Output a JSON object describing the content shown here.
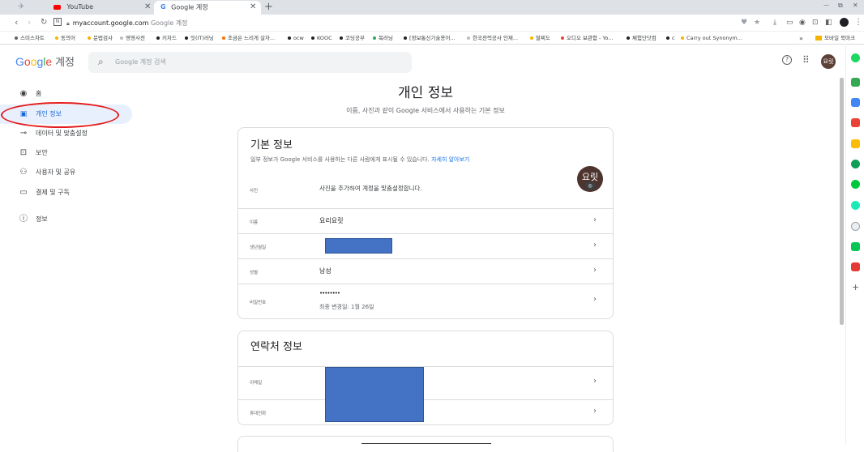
{
  "browser": {
    "tabs": [
      {
        "title": "YouTube",
        "icon": "youtube-icon"
      },
      {
        "title": "Google 계정",
        "icon": "google-g-icon"
      }
    ],
    "new_tab": "+",
    "window_controls": {
      "minimize": "—",
      "restore": "⧉",
      "close": "✕"
    },
    "address": {
      "domain": "myaccount.google.com",
      "page_title": "Google 계정"
    },
    "bookmarks": [
      {
        "label": "스미스차트",
        "color": "#5f6368"
      },
      {
        "label": "동의어",
        "color": "#f4b400"
      },
      {
        "label": "문법검사",
        "color": "#f4b400"
      },
      {
        "label": "영영사전",
        "color": "#bdbdbd"
      },
      {
        "label": "키차드",
        "color": "#202124"
      },
      {
        "label": "잇(IT)러닝",
        "color": "#202124"
      },
      {
        "label": "조금은 느리게 살자...",
        "color": "#ff6d00"
      },
      {
        "label": "ocw",
        "color": "#202124"
      },
      {
        "label": "KOOC",
        "color": "#202124"
      },
      {
        "label": "코딩공부",
        "color": "#202124"
      },
      {
        "label": "복러닝",
        "color": "#34a853"
      },
      {
        "label": "[정보통신기술용어...",
        "color": "#202124"
      },
      {
        "label": "한국전력공사 인재...",
        "color": "#bdbdbd"
      },
      {
        "label": "딸찌도",
        "color": "#f4b400"
      },
      {
        "label": "오디오 보관함 - Yo...",
        "color": "#ea4335"
      },
      {
        "label": "체험단닷컴",
        "color": "#202124"
      },
      {
        "label": "c",
        "color": "#202124"
      },
      {
        "label": "Carry out Synonym...",
        "color": "#f4b400"
      }
    ],
    "bookmarks_more": "»",
    "mobile_bookmarks": "모바일 북마크"
  },
  "header": {
    "logo_google": "Google",
    "logo_suffix": "계정",
    "search_placeholder": "Google 계정 검색",
    "avatar_initials": "요릿"
  },
  "nav": {
    "items": [
      {
        "label": "홈",
        "icon": "account-circle-icon"
      },
      {
        "label": "개인 정보",
        "icon": "id-card-icon"
      },
      {
        "label": "데이터 및 맞춤설정",
        "icon": "toggle-icon"
      },
      {
        "label": "보안",
        "icon": "lock-icon"
      },
      {
        "label": "사용자 및 공유",
        "icon": "people-icon"
      },
      {
        "label": "결제 및 구독",
        "icon": "credit-card-icon"
      },
      {
        "label": "정보",
        "icon": "info-icon"
      }
    ]
  },
  "main": {
    "title": "개인 정보",
    "subtitle": "이름, 사진과 같이 Google 서비스에서 사용하는 기본 정보",
    "basic": {
      "title": "기본 정보",
      "desc": "일부 정보가 Google 서비스를 사용하는 다른 사람에게 표시될 수 있습니다.",
      "learn_more": "자세히 알아보기",
      "photo_label": "사진",
      "photo_desc": "사진을 추가하여 계정을 맞춤설정합니다.",
      "avatar_initials": "요릿",
      "name_label": "이름",
      "name_value": "요리요릿",
      "birthday_label": "생년월일",
      "gender_label": "성별",
      "gender_value": "남성",
      "password_label": "비밀번호",
      "password_value": "••••••••",
      "password_changed": "최종 변경일: 1월 26일"
    },
    "contact": {
      "title": "연락처 정보",
      "email_label": "이메일",
      "phone_label": "휴대전화"
    }
  }
}
